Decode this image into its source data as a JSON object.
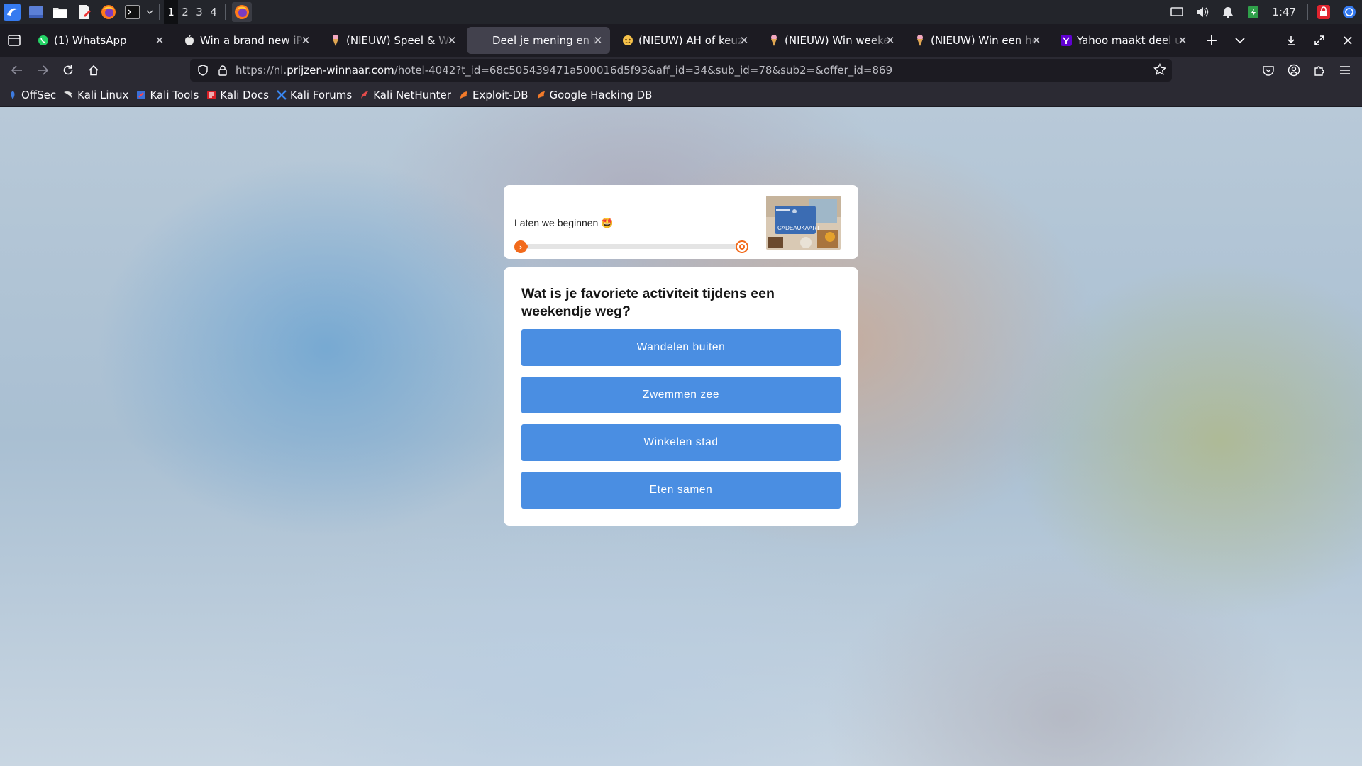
{
  "os_panel": {
    "workspaces": [
      "1",
      "2",
      "3",
      "4"
    ],
    "active_workspace": "1",
    "clock": "1:47"
  },
  "tabs": [
    {
      "title": "(1) WhatsApp",
      "icon": "whatsapp-icon",
      "active": false
    },
    {
      "title": "Win a brand new iPhone",
      "icon": "apple-icon",
      "active": false
    },
    {
      "title": "(NIEUW) Speel & Win De",
      "icon": "ice-cream-icon",
      "active": false
    },
    {
      "title": "Deel je mening en win",
      "icon": "",
      "active": true
    },
    {
      "title": "(NIEUW) AH of keuze k",
      "icon": "emoji-icon",
      "active": false
    },
    {
      "title": "(NIEUW) Win weekend",
      "icon": "ice-cream-icon",
      "active": false
    },
    {
      "title": "(NIEUW) Win een hem",
      "icon": "ice-cream-icon",
      "active": false
    },
    {
      "title": "Yahoo maakt deel uit v",
      "icon": "yahoo-icon",
      "active": false
    }
  ],
  "urlbar": {
    "prefix": "https://nl.",
    "host": "prijzen-winnaar.com",
    "path": "/hotel-4042?t_id=68c505439471a500016d5f93&aff_id=34&sub_id=78&sub2=&offer_id=869"
  },
  "bookmarks": [
    {
      "label": "OffSec",
      "icon": "offsec-icon"
    },
    {
      "label": "Kali Linux",
      "icon": "kali-dragon-icon"
    },
    {
      "label": "Kali Tools",
      "icon": "kali-tools-icon"
    },
    {
      "label": "Kali Docs",
      "icon": "kali-docs-icon"
    },
    {
      "label": "Kali Forums",
      "icon": "kali-forums-icon"
    },
    {
      "label": "Kali NetHunter",
      "icon": "nethunter-icon"
    },
    {
      "label": "Exploit-DB",
      "icon": "exploit-db-icon"
    },
    {
      "label": "Google Hacking DB",
      "icon": "ghdb-icon"
    }
  ],
  "survey": {
    "status_text": "Laten we beginnen 🤩",
    "progress": 0.05,
    "question": "Wat is je favoriete activiteit tijdens een weekendje weg?",
    "answers": [
      "Wandelen buiten",
      "Zwemmen zee",
      "Winkelen stad",
      "Eten samen"
    ],
    "prize_text": "CADEAUKAART"
  },
  "colors": {
    "accent_orange": "#f26a1b",
    "answer_blue": "#4a8ee2",
    "browser_bg": "#1c1b22",
    "toolbar_bg": "#2b2a33"
  }
}
